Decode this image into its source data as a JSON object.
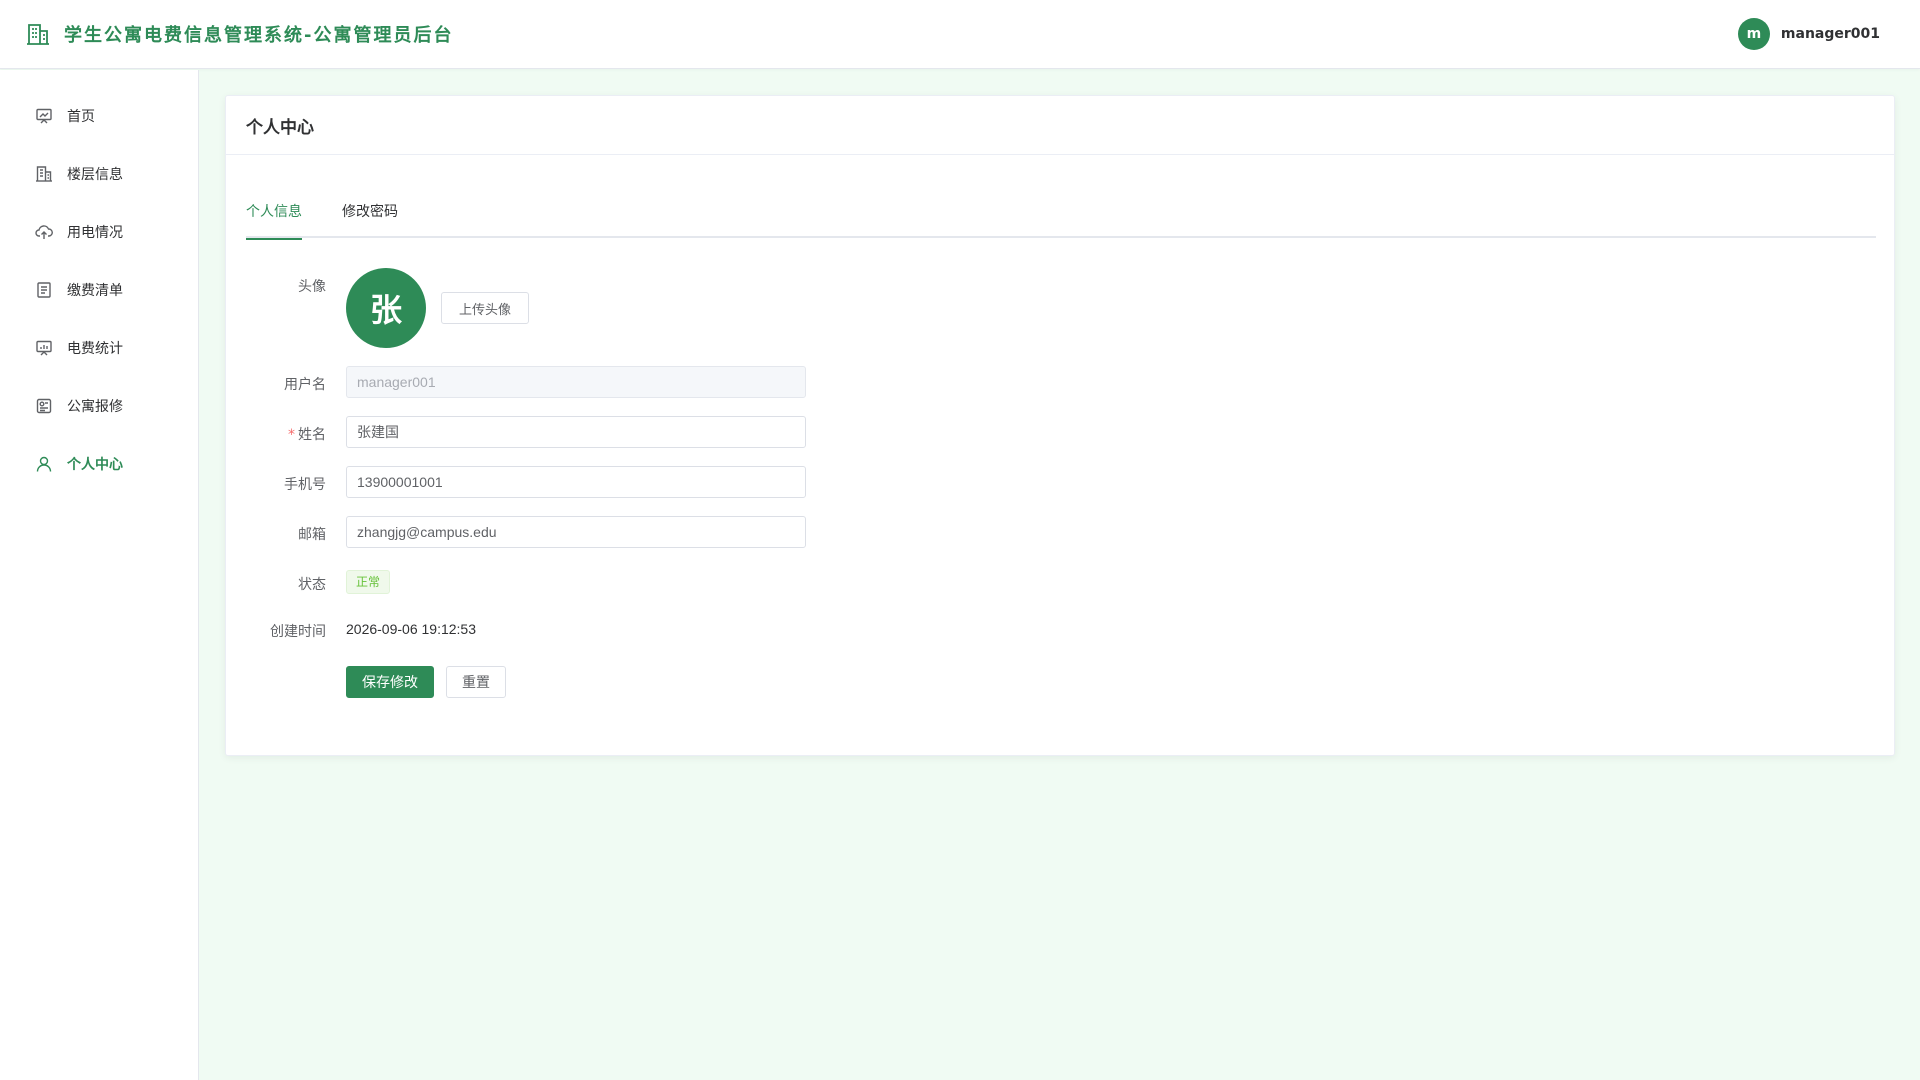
{
  "header": {
    "icon": "building-icon",
    "title": "学生公寓电费信息管理系统-公寓管理员后台",
    "user": {
      "avatar_initial": "m",
      "name": "manager001"
    }
  },
  "sidebar": {
    "items": [
      {
        "label": "首页",
        "icon": "dashboard-icon",
        "active": false
      },
      {
        "label": "楼层信息",
        "icon": "building-icon",
        "active": false
      },
      {
        "label": "用电情况",
        "icon": "cloud-upload-icon",
        "active": false
      },
      {
        "label": "缴费清单",
        "icon": "document-icon",
        "active": false
      },
      {
        "label": "电费统计",
        "icon": "chart-board-icon",
        "active": false
      },
      {
        "label": "公寓报修",
        "icon": "repair-icon",
        "active": false
      },
      {
        "label": "个人中心",
        "icon": "user-icon",
        "active": true
      }
    ]
  },
  "card": {
    "title": "个人中心",
    "tabs": [
      {
        "label": "个人信息",
        "active": true
      },
      {
        "label": "修改密码",
        "active": false
      }
    ]
  },
  "form": {
    "avatar_label": "头像",
    "avatar_char": "张",
    "upload_button": "上传头像",
    "username_label": "用户名",
    "username_value": "manager001",
    "name_required_mark": "*",
    "name_label": "姓名",
    "name_value": "张建国",
    "phone_label": "手机号",
    "phone_value": "13900001001",
    "email_label": "邮箱",
    "email_value": "zhangjg@campus.edu",
    "status_label": "状态",
    "status_value": "正常",
    "created_label": "创建时间",
    "created_value": "2026-09-06 19:12:53",
    "save_button": "保存修改",
    "reset_button": "重置"
  },
  "colors": {
    "accent": "#2e8b57",
    "page_bg": "#f0fbf3",
    "success": "#67c23a",
    "required": "#f56c6c"
  }
}
